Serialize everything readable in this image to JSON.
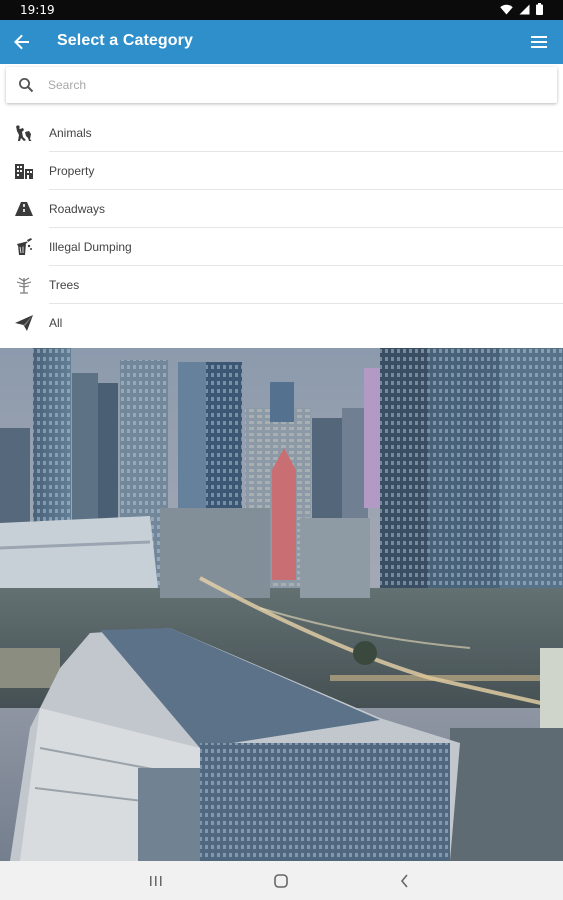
{
  "status_bar": {
    "time": "19:19"
  },
  "app_bar": {
    "title": "Select a Category"
  },
  "search": {
    "placeholder": "Search",
    "value": ""
  },
  "categories": [
    {
      "label": "Animals",
      "icon": "animal-icon"
    },
    {
      "label": "Property",
      "icon": "property-icon"
    },
    {
      "label": "Roadways",
      "icon": "roadway-icon"
    },
    {
      "label": "Illegal Dumping",
      "icon": "dumping-icon"
    },
    {
      "label": "Trees",
      "icon": "tree-icon"
    },
    {
      "label": "All",
      "icon": "send-icon"
    }
  ],
  "colors": {
    "app_bar": "#2f8fcb",
    "status_bar": "#0b0b0b",
    "text": "#444444"
  }
}
